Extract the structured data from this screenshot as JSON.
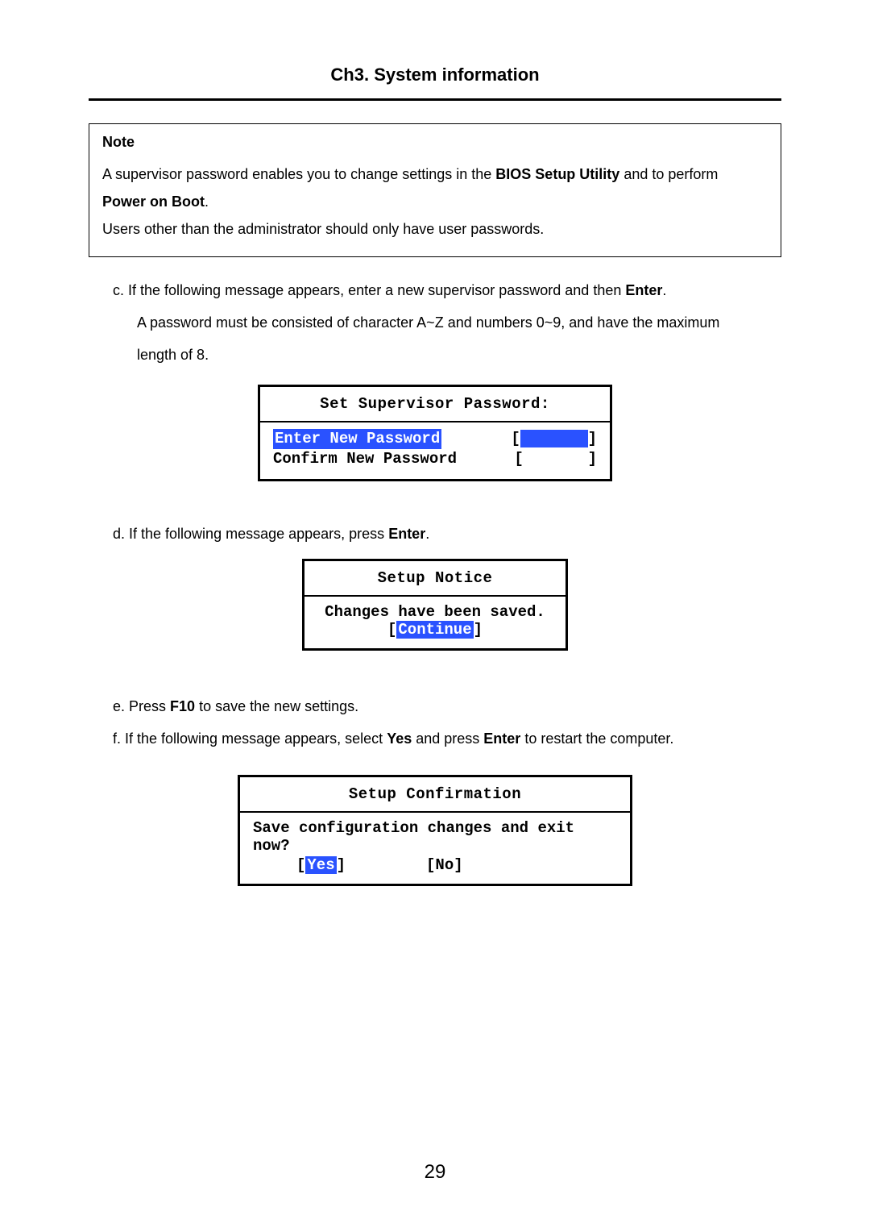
{
  "header": {
    "title": "Ch3. System information"
  },
  "note": {
    "title": "Note",
    "line1_a": "A supervisor password enables you to change settings in the ",
    "line1_b": "BIOS Setup Utility",
    "line1_c": " and to perform ",
    "line2_a": "Power on Boot",
    "line2_b": ".",
    "line3": "Users other than the administrator should only have user passwords."
  },
  "step_c": {
    "prefix": "c. If the following message appears, enter a new supervisor password and then ",
    "enter": "Enter",
    "suffix": ".",
    "line2": "A password must be consisted of character A~Z and numbers 0~9, and have the maximum",
    "line3": "length of 8."
  },
  "dialog1": {
    "title": "Set Supervisor Password:",
    "enter_label": "Enter New Password",
    "confirm_label": "Confirm New Password",
    "field_open": "[",
    "field_close": "]",
    "field_space": "       "
  },
  "step_d": {
    "prefix": "d. If the following message appears, press ",
    "enter": "Enter",
    "suffix": "."
  },
  "dialog2": {
    "title": "Setup Notice",
    "line": "Changes have been saved.",
    "continue": "Continue",
    "lbracket": "[",
    "rbracket": "]"
  },
  "step_e": {
    "prefix": "e. Press ",
    "f10": "F10",
    "suffix": " to save the new settings."
  },
  "step_f": {
    "prefix": "f. If the following message appears, select ",
    "yes": "Yes",
    "mid": " and press ",
    "enter": "Enter",
    "suffix": " to restart the computer."
  },
  "dialog3": {
    "title": "Setup Confirmation",
    "line": "Save configuration changes and exit now?",
    "yes": "Yes",
    "no": "[No]",
    "lbracket": "[",
    "rbracket": "]"
  },
  "page_number": "29"
}
